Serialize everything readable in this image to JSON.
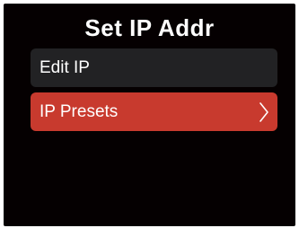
{
  "header": {
    "title": "Set IP Addr"
  },
  "menu": {
    "items": [
      {
        "label": "Edit IP",
        "selected": false
      },
      {
        "label": "IP Presets",
        "selected": true,
        "icon": "chevron-right-icon"
      }
    ]
  },
  "colors": {
    "background": "#050001",
    "item": "#222224",
    "selected_item": "#c83a2e",
    "text": "#ffffff"
  }
}
